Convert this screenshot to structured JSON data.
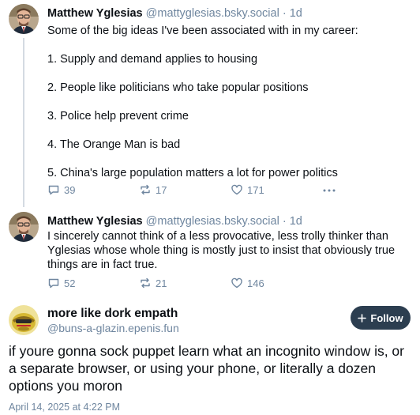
{
  "posts": [
    {
      "author_name": "Matthew Yglesias",
      "handle": "@mattyglesias.bsky.social",
      "separator": "·",
      "age": "1d",
      "lines": [
        "Some of the big ideas I've been associated with in my career:",
        "1. Supply and demand applies to housing",
        "2. People like politicians who take popular positions",
        "3. Police help prevent crime",
        "4. The Orange Man is bad",
        "5. China's large population matters a lot for power politics"
      ],
      "replies": "39",
      "reposts": "17",
      "likes": "171"
    },
    {
      "author_name": "Matthew Yglesias",
      "handle": "@mattyglesias.bsky.social",
      "separator": "·",
      "age": "1d",
      "lines": [
        "I sincerely cannot think of a less provocative, less trolly thinker than",
        "Yglesias whose whole thing is mostly just to insist that obviously true",
        "things are in fact true."
      ],
      "replies": "52",
      "reposts": "21",
      "likes": "146"
    }
  ],
  "main_post": {
    "author_name": "more like dork empath",
    "handle": "@buns-a-glazin.epenis.fun",
    "follow_label": "Follow",
    "text": "if youre gonna sock puppet learn what an incognito window is, or a separate browser, or using your phone, or literally a dozen options you moron",
    "timestamp": "April 14, 2025 at 4:22 PM"
  },
  "icons": {
    "reply": "reply-icon",
    "repost": "repost-icon",
    "like": "heart-icon",
    "more": "more-options-icon",
    "follow": "plus-icon"
  },
  "colors": {
    "muted": "#6f869f",
    "thread_line": "#d4dbe2",
    "follow_bg": "#2c3e50"
  }
}
